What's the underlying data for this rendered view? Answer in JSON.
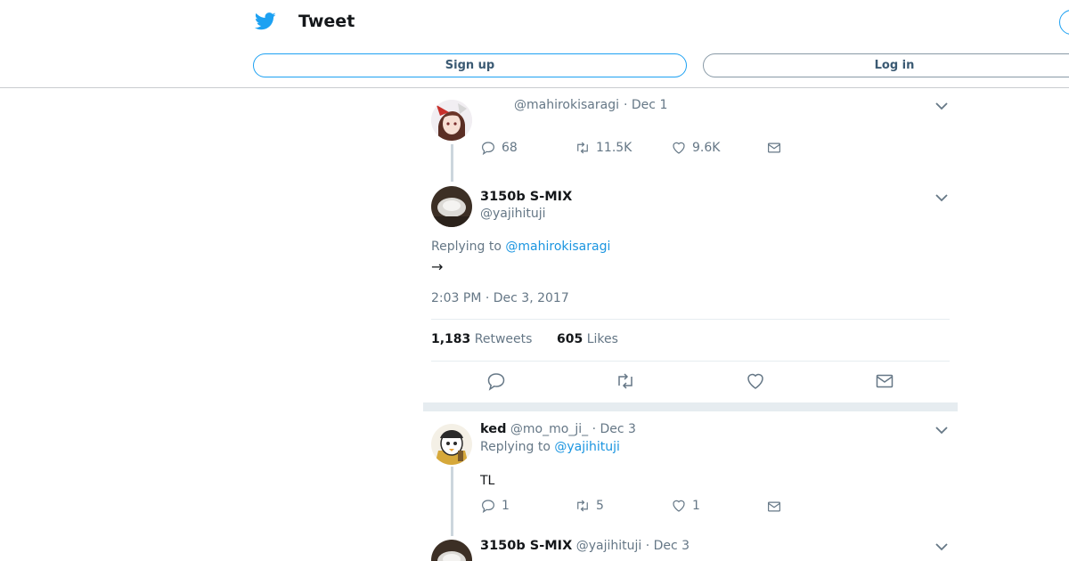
{
  "header": {
    "title": "Tweet",
    "signup_label": "Sign up",
    "login_label": "Log in"
  },
  "parent_tweet": {
    "handle": "@mahirokisaragi",
    "date": "· Dec 1",
    "replies": "68",
    "retweets": "11.5K",
    "likes": "9.6K"
  },
  "main_tweet": {
    "name": "3150b S-MIX",
    "handle": "@yajihituji",
    "replying_prefix": "Replying to",
    "replying_to": "@mahirokisaragi",
    "text": "→",
    "timestamp": "2:03 PM · Dec 3, 2017",
    "retweet_count": "1,183",
    "retweet_label": "Retweets",
    "like_count": "605",
    "like_label": "Likes"
  },
  "reply_1": {
    "name": "ked",
    "handle": "@mo_mo_ji_",
    "date": "· Dec 3",
    "replying_prefix": "Replying to",
    "replying_to": "@yajihituji",
    "text": "TL",
    "replies": "1",
    "retweets": "5",
    "likes": "1"
  },
  "reply_2": {
    "name": "3150b S-MIX",
    "handle": "@yajihituji",
    "date": "· Dec 3"
  },
  "colors": {
    "accent": "#1da1f2",
    "link": "#1b95e0",
    "muted": "#657786",
    "separator": "#e6ecf0"
  },
  "icons": [
    "twitter-bird-icon",
    "chevron-down-icon",
    "reply-icon",
    "retweet-icon",
    "heart-icon",
    "mail-icon"
  ]
}
